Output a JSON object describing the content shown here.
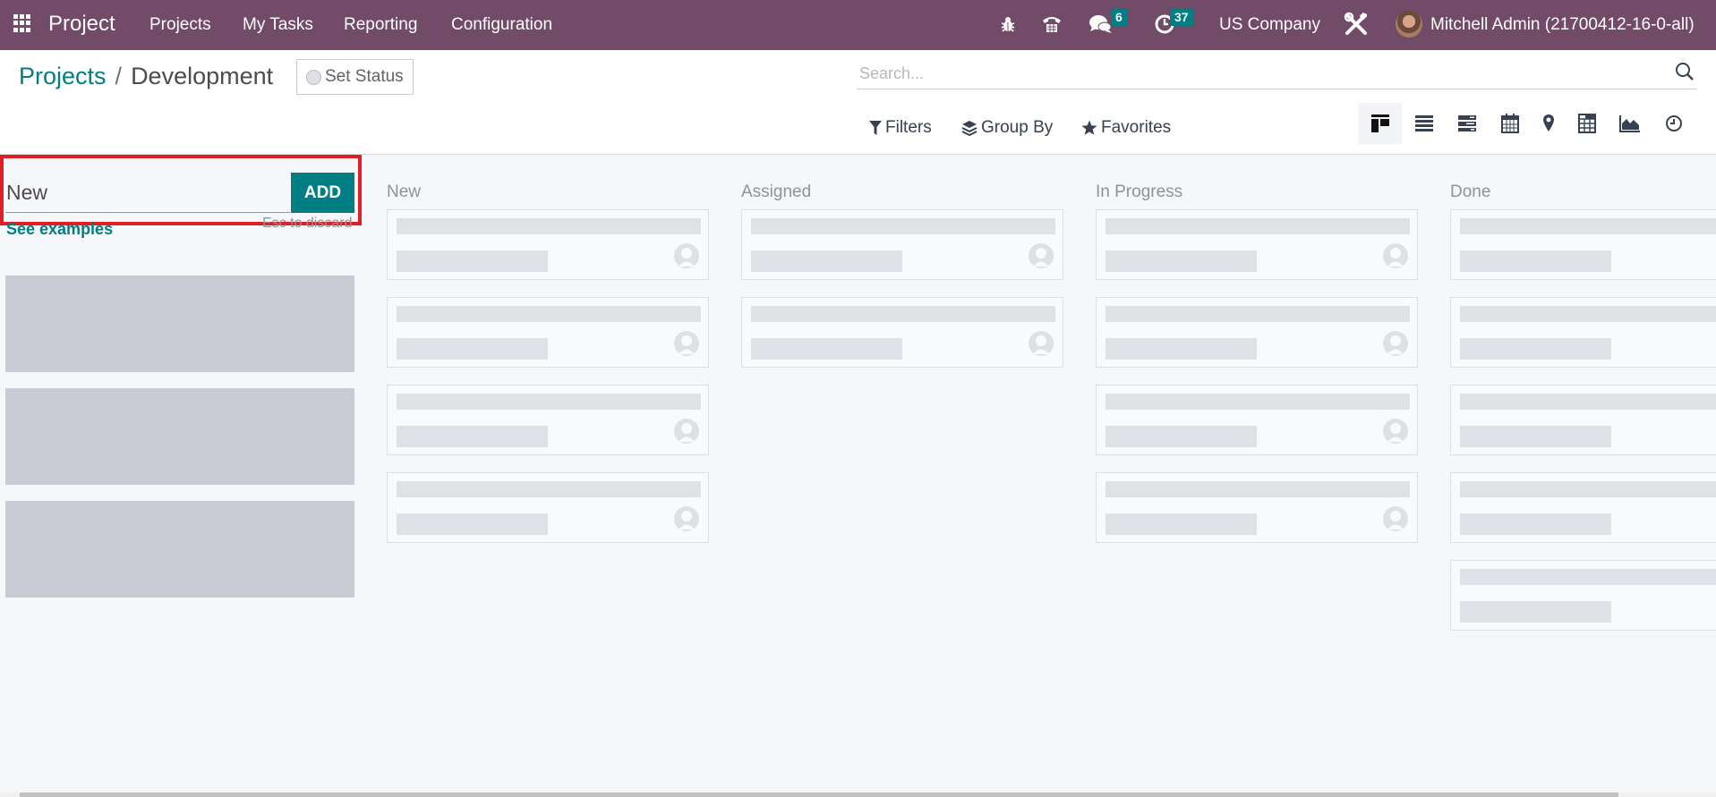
{
  "navbar": {
    "app_name": "Project",
    "menu": [
      "Projects",
      "My Tasks",
      "Reporting",
      "Configuration"
    ],
    "messages_count": "6",
    "activities_count": "37",
    "company": "US Company",
    "user": "Mitchell Admin (21700412-16-0-all)",
    "icons": [
      "apps-grid-icon",
      "debug-bug-icon",
      "phone-icon",
      "chat-icon",
      "clock-activity-icon",
      "tools-icon"
    ],
    "colors": {
      "navbar_bg": "#714b67",
      "badge_bg": "#017e84"
    }
  },
  "control_panel": {
    "breadcrumb": {
      "parent": "Projects",
      "separator": "/",
      "current": "Development"
    },
    "set_status_label": "Set Status",
    "search": {
      "placeholder": "Search...",
      "value": ""
    },
    "filters_label": "Filters",
    "group_by_label": "Group By",
    "favorites_label": "Favorites",
    "views": [
      {
        "name": "kanban",
        "active": true
      },
      {
        "name": "list",
        "active": false
      },
      {
        "name": "gantt",
        "active": false
      },
      {
        "name": "calendar",
        "active": false
      },
      {
        "name": "map",
        "active": false
      },
      {
        "name": "pivot",
        "active": false
      },
      {
        "name": "graph",
        "active": false
      },
      {
        "name": "activity",
        "active": false
      }
    ]
  },
  "quick_create": {
    "input_value": "New",
    "add_label": "ADD",
    "examples_link": "See examples",
    "discard_hint": "Esc to discard",
    "highlight_color": "#e01e26"
  },
  "kanban": {
    "columns": [
      {
        "title": "New",
        "placeholder_cards": 4,
        "show_avatar": true
      },
      {
        "title": "Assigned",
        "placeholder_cards": 2,
        "show_avatar": true
      },
      {
        "title": "In Progress",
        "placeholder_cards": 4,
        "show_avatar": true
      },
      {
        "title": "Done",
        "placeholder_cards": 5,
        "show_avatar": false
      }
    ],
    "ghost_blocks": 3
  }
}
